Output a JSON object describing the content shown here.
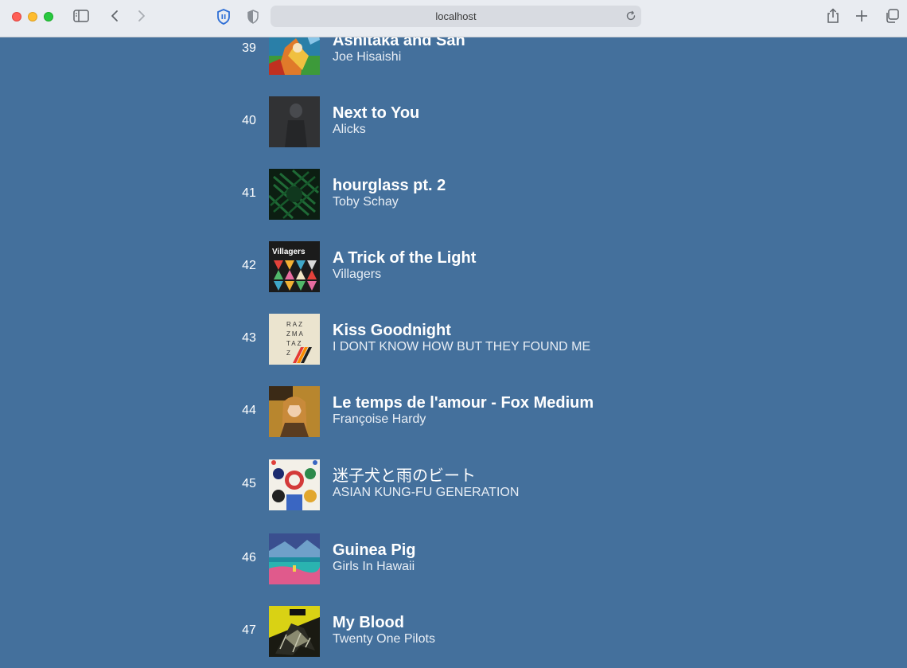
{
  "browser": {
    "url": "localhost"
  },
  "tracks": [
    {
      "rank": "39",
      "title": "Ashitaka and San",
      "artist": "Joe Hisaishi"
    },
    {
      "rank": "40",
      "title": "Next to You",
      "artist": "Alicks"
    },
    {
      "rank": "41",
      "title": "hourglass pt. 2",
      "artist": "Toby Schay"
    },
    {
      "rank": "42",
      "title": "A Trick of the Light",
      "artist": "Villagers"
    },
    {
      "rank": "43",
      "title": "Kiss Goodnight",
      "artist": "I DONT KNOW HOW BUT THEY FOUND ME"
    },
    {
      "rank": "44",
      "title": "Le temps de l'amour - Fox Medium",
      "artist": "Françoise Hardy"
    },
    {
      "rank": "45",
      "title": "迷子犬と雨のビート",
      "artist": "ASIAN KUNG-FU GENERATION"
    },
    {
      "rank": "46",
      "title": "Guinea Pig",
      "artist": "Girls In Hawaii"
    },
    {
      "rank": "47",
      "title": "My Blood",
      "artist": "Twenty One Pilots"
    }
  ],
  "covers": {
    "villagers_text": "Villagers",
    "razzmatazz_text": [
      "RAZ",
      "ZMA",
      "TAZ",
      "Z"
    ]
  },
  "colors": {
    "page_background": "#44709c",
    "toolbar_background": "#e9ecf1"
  }
}
